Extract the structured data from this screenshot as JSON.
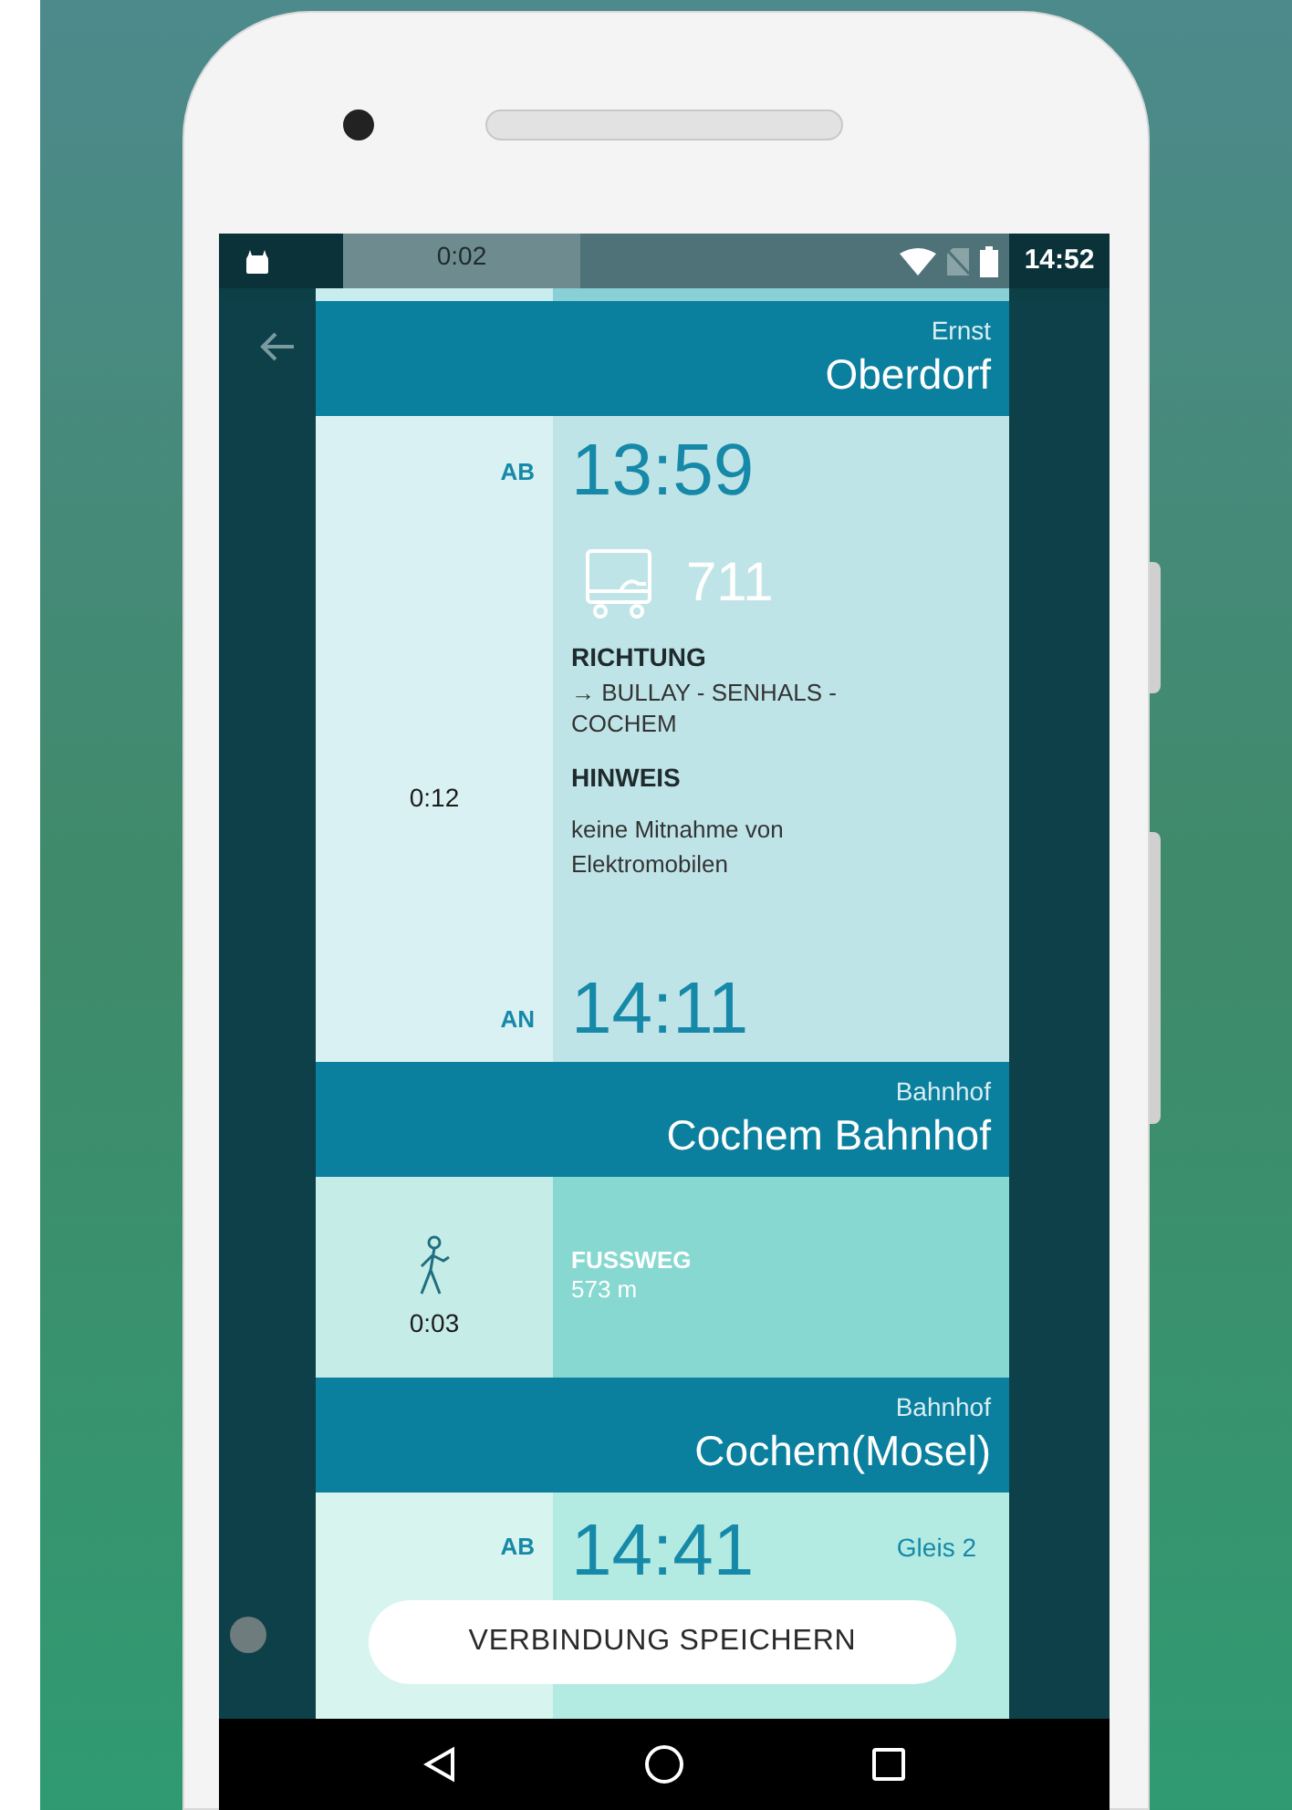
{
  "status_bar": {
    "time": "14:52"
  },
  "top_leg": {
    "duration": "0:02"
  },
  "journey": [
    {
      "kind": "stop",
      "label": "Ernst",
      "name": "Oberdorf"
    },
    {
      "kind": "ride",
      "dep_label": "AB",
      "dep_time": "13:59",
      "line": "711",
      "duration": "0:12",
      "direction_label": "RICHTUNG",
      "direction": "→ BULLAY - SENHALS - COCHEM",
      "note_label": "HINWEIS",
      "note": "keine Mitnahme von Elektromobilen",
      "arr_label": "AN",
      "arr_time": "14:11"
    },
    {
      "kind": "stop",
      "label": "Bahnhof",
      "name": "Cochem Bahnhof"
    },
    {
      "kind": "walk",
      "title": "FUSSWEG",
      "distance": "573 m",
      "duration": "0:03"
    },
    {
      "kind": "stop",
      "label": "Bahnhof",
      "name": "Cochem(Mosel)"
    },
    {
      "kind": "partial",
      "dep_label": "AB",
      "dep_time": "14:41",
      "platform": "Gleis 2"
    }
  ],
  "save_button": "VERBINDUNG SPEICHERN"
}
